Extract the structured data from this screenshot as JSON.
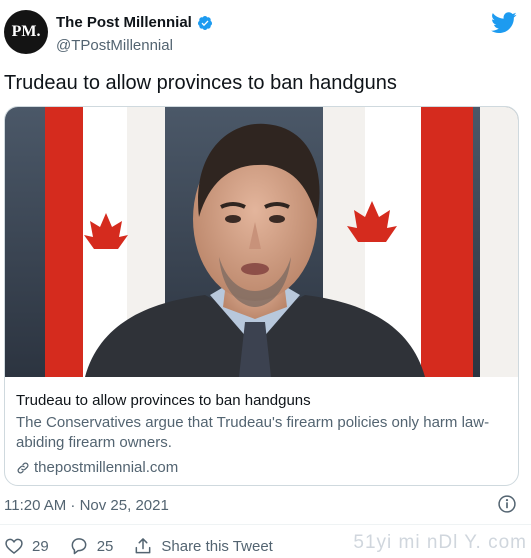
{
  "account": {
    "avatar_text": "PM.",
    "display_name": "The Post Millennial",
    "handle": "@TPostMillennial"
  },
  "tweet": {
    "text": "Trudeau to allow provinces to ban handguns",
    "timestamp": "11:20 AM · Nov 25, 2021"
  },
  "card": {
    "title": "Trudeau to allow provinces to ban handguns",
    "description": "The Conservatives argue that Trudeau's firearm policies only harm law-abiding firearm owners.",
    "domain": "thepostmillennial.com"
  },
  "actions": {
    "likes": "29",
    "replies": "25",
    "share_label": "Share this Tweet"
  },
  "watermark": "51yi mi nDl Y. com",
  "colors": {
    "twitter_blue": "#1d9bf0",
    "text_primary": "#0f1419",
    "text_secondary": "#536471",
    "border": "#cfd9de",
    "flag_red": "#d52b1e"
  },
  "icons": [
    "verified-badge-icon",
    "twitter-bird-icon",
    "link-icon",
    "info-icon",
    "heart-icon",
    "reply-icon",
    "share-icon"
  ]
}
